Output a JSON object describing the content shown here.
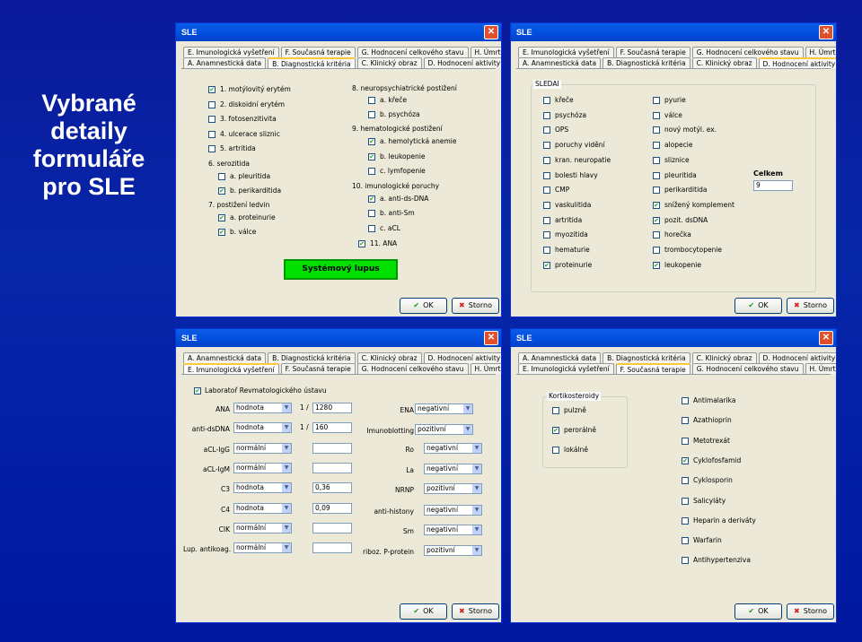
{
  "slide_title": [
    "Vybrané",
    "detaily",
    "formuláře",
    "pro SLE"
  ],
  "win1": {
    "title": "SLE",
    "tabs_back": [
      "E. Imunologická vyšetření",
      "F. Současná terapie",
      "G. Hodnocení celkového stavu",
      "H. Úmrtí"
    ],
    "tabs_front": [
      "A. Anamnestická data",
      "B. Diagnostická kritéria",
      "C. Klinický obraz",
      "D. Hodnocení aktivity SLE"
    ],
    "left_items": [
      {
        "t": "1. motýlovitý erytém",
        "c": true
      },
      {
        "t": "2. diskoidní erytém",
        "c": false
      },
      {
        "t": "3. fotosenzitivita",
        "c": false
      },
      {
        "t": "4. ulcerace sliznic",
        "c": false
      },
      {
        "t": "5. artritida",
        "c": false
      }
    ],
    "serozitida": "6. serozitida",
    "serozitida_items": [
      {
        "t": "a. pleuritida",
        "c": false
      },
      {
        "t": "b. perikarditida",
        "c": true
      }
    ],
    "ledviny": "7. postižení ledvin",
    "ledviny_items": [
      {
        "t": "a. proteinurie",
        "c": true
      },
      {
        "t": "b. válce",
        "c": true
      }
    ],
    "neuro": "8. neuropsychiatrické postižení",
    "neuro_items": [
      {
        "t": "a. křeče",
        "c": false
      },
      {
        "t": "b. psychóza",
        "c": false
      }
    ],
    "hema": "9. hematologické postižení",
    "hema_items": [
      {
        "t": "a. hemolytická anemie",
        "c": true
      },
      {
        "t": "b. leukopenie",
        "c": true
      },
      {
        "t": "c. lymfopenie",
        "c": false
      }
    ],
    "imuno": "10. imunologické poruchy",
    "imuno_items": [
      {
        "t": "a. anti-ds-DNA",
        "c": true
      },
      {
        "t": "b. anti-Sm",
        "c": false
      },
      {
        "t": "c. aCL",
        "c": false
      }
    ],
    "ana": {
      "t": "11. ANA",
      "c": true
    },
    "result": "Systémový lupus",
    "ok": "OK",
    "cancel": "Storno"
  },
  "win2": {
    "title": "SLE",
    "tabs_back": [
      "E. Imunologická vyšetření",
      "F. Současná terapie",
      "G. Hodnocení celkového stavu",
      "H. Úmrtí"
    ],
    "tabs_front": [
      "A. Anamnestická data",
      "B. Diagnostická kritéria",
      "C. Klinický obraz",
      "D. Hodnocení aktivity SLE"
    ],
    "group": "SLEDAI",
    "col1": [
      {
        "t": "křeče",
        "c": false
      },
      {
        "t": "psychóza",
        "c": false
      },
      {
        "t": "OPS",
        "c": false
      },
      {
        "t": "poruchy vidění",
        "c": false
      },
      {
        "t": "kran. neuropatie",
        "c": false
      },
      {
        "t": "bolesti hlavy",
        "c": false
      },
      {
        "t": "CMP",
        "c": false
      },
      {
        "t": "vaskulitida",
        "c": false
      },
      {
        "t": "artritida",
        "c": false
      },
      {
        "t": "myozitida",
        "c": false
      },
      {
        "t": "hematurie",
        "c": false
      },
      {
        "t": "proteinurie",
        "c": true
      }
    ],
    "col2": [
      {
        "t": "pyurie",
        "c": false
      },
      {
        "t": "válce",
        "c": false
      },
      {
        "t": "nový motýl. ex.",
        "c": false
      },
      {
        "t": "alopecie",
        "c": false
      },
      {
        "t": "sliznice",
        "c": false
      },
      {
        "t": "pleuritida",
        "c": false
      },
      {
        "t": "perikarditida",
        "c": false
      },
      {
        "t": "snížený komplement",
        "c": true
      },
      {
        "t": "pozit. dsDNA",
        "c": true
      },
      {
        "t": "horečka",
        "c": false
      },
      {
        "t": "trombocytopenie",
        "c": false
      },
      {
        "t": "leukopenie",
        "c": true
      }
    ],
    "celkem_label": "Celkem",
    "celkem_value": "9",
    "ok": "OK",
    "cancel": "Storno"
  },
  "win3": {
    "title": "SLE",
    "tabs_back": [
      "A. Anamnestická data",
      "B. Diagnostická kritéria",
      "C. Klinický obraz",
      "D. Hodnocení aktivity SLE"
    ],
    "tabs_front": [
      "E. Imunologická vyšetření",
      "F. Současná terapie",
      "G. Hodnocení celkového stavu",
      "H. Úmrtí"
    ],
    "lab": "Laboratoř Revmatologického ústavu",
    "rows": [
      {
        "l": "ANA",
        "s": "hodnota",
        "p": "1 /",
        "v": "1280"
      },
      {
        "l": "anti-dsDNA",
        "s": "hodnota",
        "p": "1 /",
        "v": "160"
      },
      {
        "l": "aCL-IgG",
        "s": "normální",
        "p": "",
        "v": ""
      },
      {
        "l": "aCL-IgM",
        "s": "normální",
        "p": "",
        "v": ""
      },
      {
        "l": "C3",
        "s": "hodnota",
        "p": "",
        "v": "0,36"
      },
      {
        "l": "C4",
        "s": "hodnota",
        "p": "",
        "v": "0,09"
      },
      {
        "l": "CIK",
        "s": "normální",
        "p": "",
        "v": ""
      },
      {
        "l": "Lup. antikoag.",
        "s": "normální",
        "p": "",
        "v": ""
      }
    ],
    "right": [
      {
        "l": "ENA",
        "s": "negativní"
      },
      {
        "l": "Imunoblotting",
        "s": "pozitivní"
      },
      {
        "l": "Ro",
        "s": "negativní"
      },
      {
        "l": "La",
        "s": "negativní"
      },
      {
        "l": "NRNP",
        "s": "pozitivní"
      },
      {
        "l": "anti-histony",
        "s": "negativní"
      },
      {
        "l": "Sm",
        "s": "negativní"
      },
      {
        "l": "riboz. P-protein",
        "s": "pozitivní"
      }
    ],
    "ok": "OK",
    "cancel": "Storno"
  },
  "win4": {
    "title": "SLE",
    "tabs_back": [
      "A. Anamnestická data",
      "B. Diagnostická kritéria",
      "C. Klinický obraz",
      "D. Hodnocení aktivity SLE"
    ],
    "tabs_front": [
      "E. Imunologická vyšetření",
      "F. Současná terapie",
      "G. Hodnocení celkového stavu",
      "H. Úmrtí"
    ],
    "group": "Kortikosteroidy",
    "kort": [
      {
        "t": "pulzně",
        "c": false
      },
      {
        "t": "perorálně",
        "c": true
      },
      {
        "t": "lokálně",
        "c": false
      }
    ],
    "drugs": [
      {
        "t": "Antimalarika",
        "c": false
      },
      {
        "t": "Azathioprin",
        "c": false
      },
      {
        "t": "Metotrexát",
        "c": false
      },
      {
        "t": "Cyklofosfamid",
        "c": true
      },
      {
        "t": "Cyklosporin",
        "c": false
      },
      {
        "t": "Salicyláty",
        "c": false
      },
      {
        "t": "Heparin a deriváty",
        "c": false
      },
      {
        "t": "Warfarin",
        "c": false
      },
      {
        "t": "Antihypertenziva",
        "c": false
      }
    ],
    "ok": "OK",
    "cancel": "Storno"
  }
}
